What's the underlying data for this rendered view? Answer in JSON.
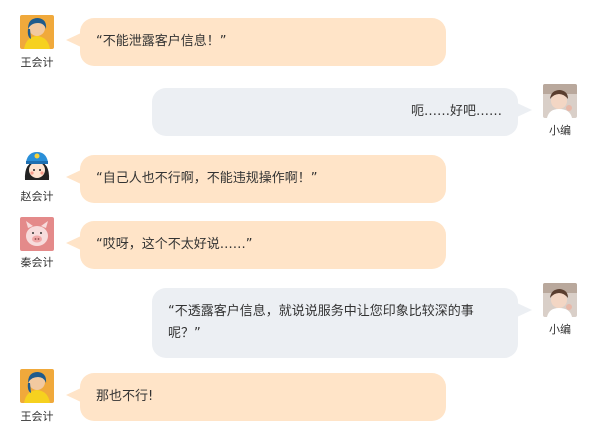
{
  "colors": {
    "left_bubble": "#ffe4c8",
    "right_bubble": "#eceff3",
    "text": "#333333"
  },
  "messages": [
    {
      "side": "left",
      "sender": "王会计",
      "avatar_icon": "blue-hair-yellow-shirt-avatar-icon",
      "text": "“不能泄露客户信息！”"
    },
    {
      "side": "right",
      "sender": "小编",
      "avatar_icon": "baby-photo-avatar-icon",
      "text": "呃……好吧……"
    },
    {
      "side": "left",
      "sender": "赵会计",
      "avatar_icon": "blue-cap-girl-avatar-icon",
      "text": "“自己人也不行啊，不能违规操作啊！”"
    },
    {
      "side": "left",
      "sender": "秦会计",
      "avatar_icon": "pig-avatar-icon",
      "text": "“哎呀，这个不太好说……”"
    },
    {
      "side": "right",
      "sender": "小编",
      "avatar_icon": "baby-photo-avatar-icon",
      "text": "“不透露客户信息，就说说服务中让您印象比较深的事呢？”"
    },
    {
      "side": "left",
      "sender": "王会计",
      "avatar_icon": "blue-hair-yellow-shirt-avatar-icon",
      "text": "那也不行!"
    }
  ]
}
